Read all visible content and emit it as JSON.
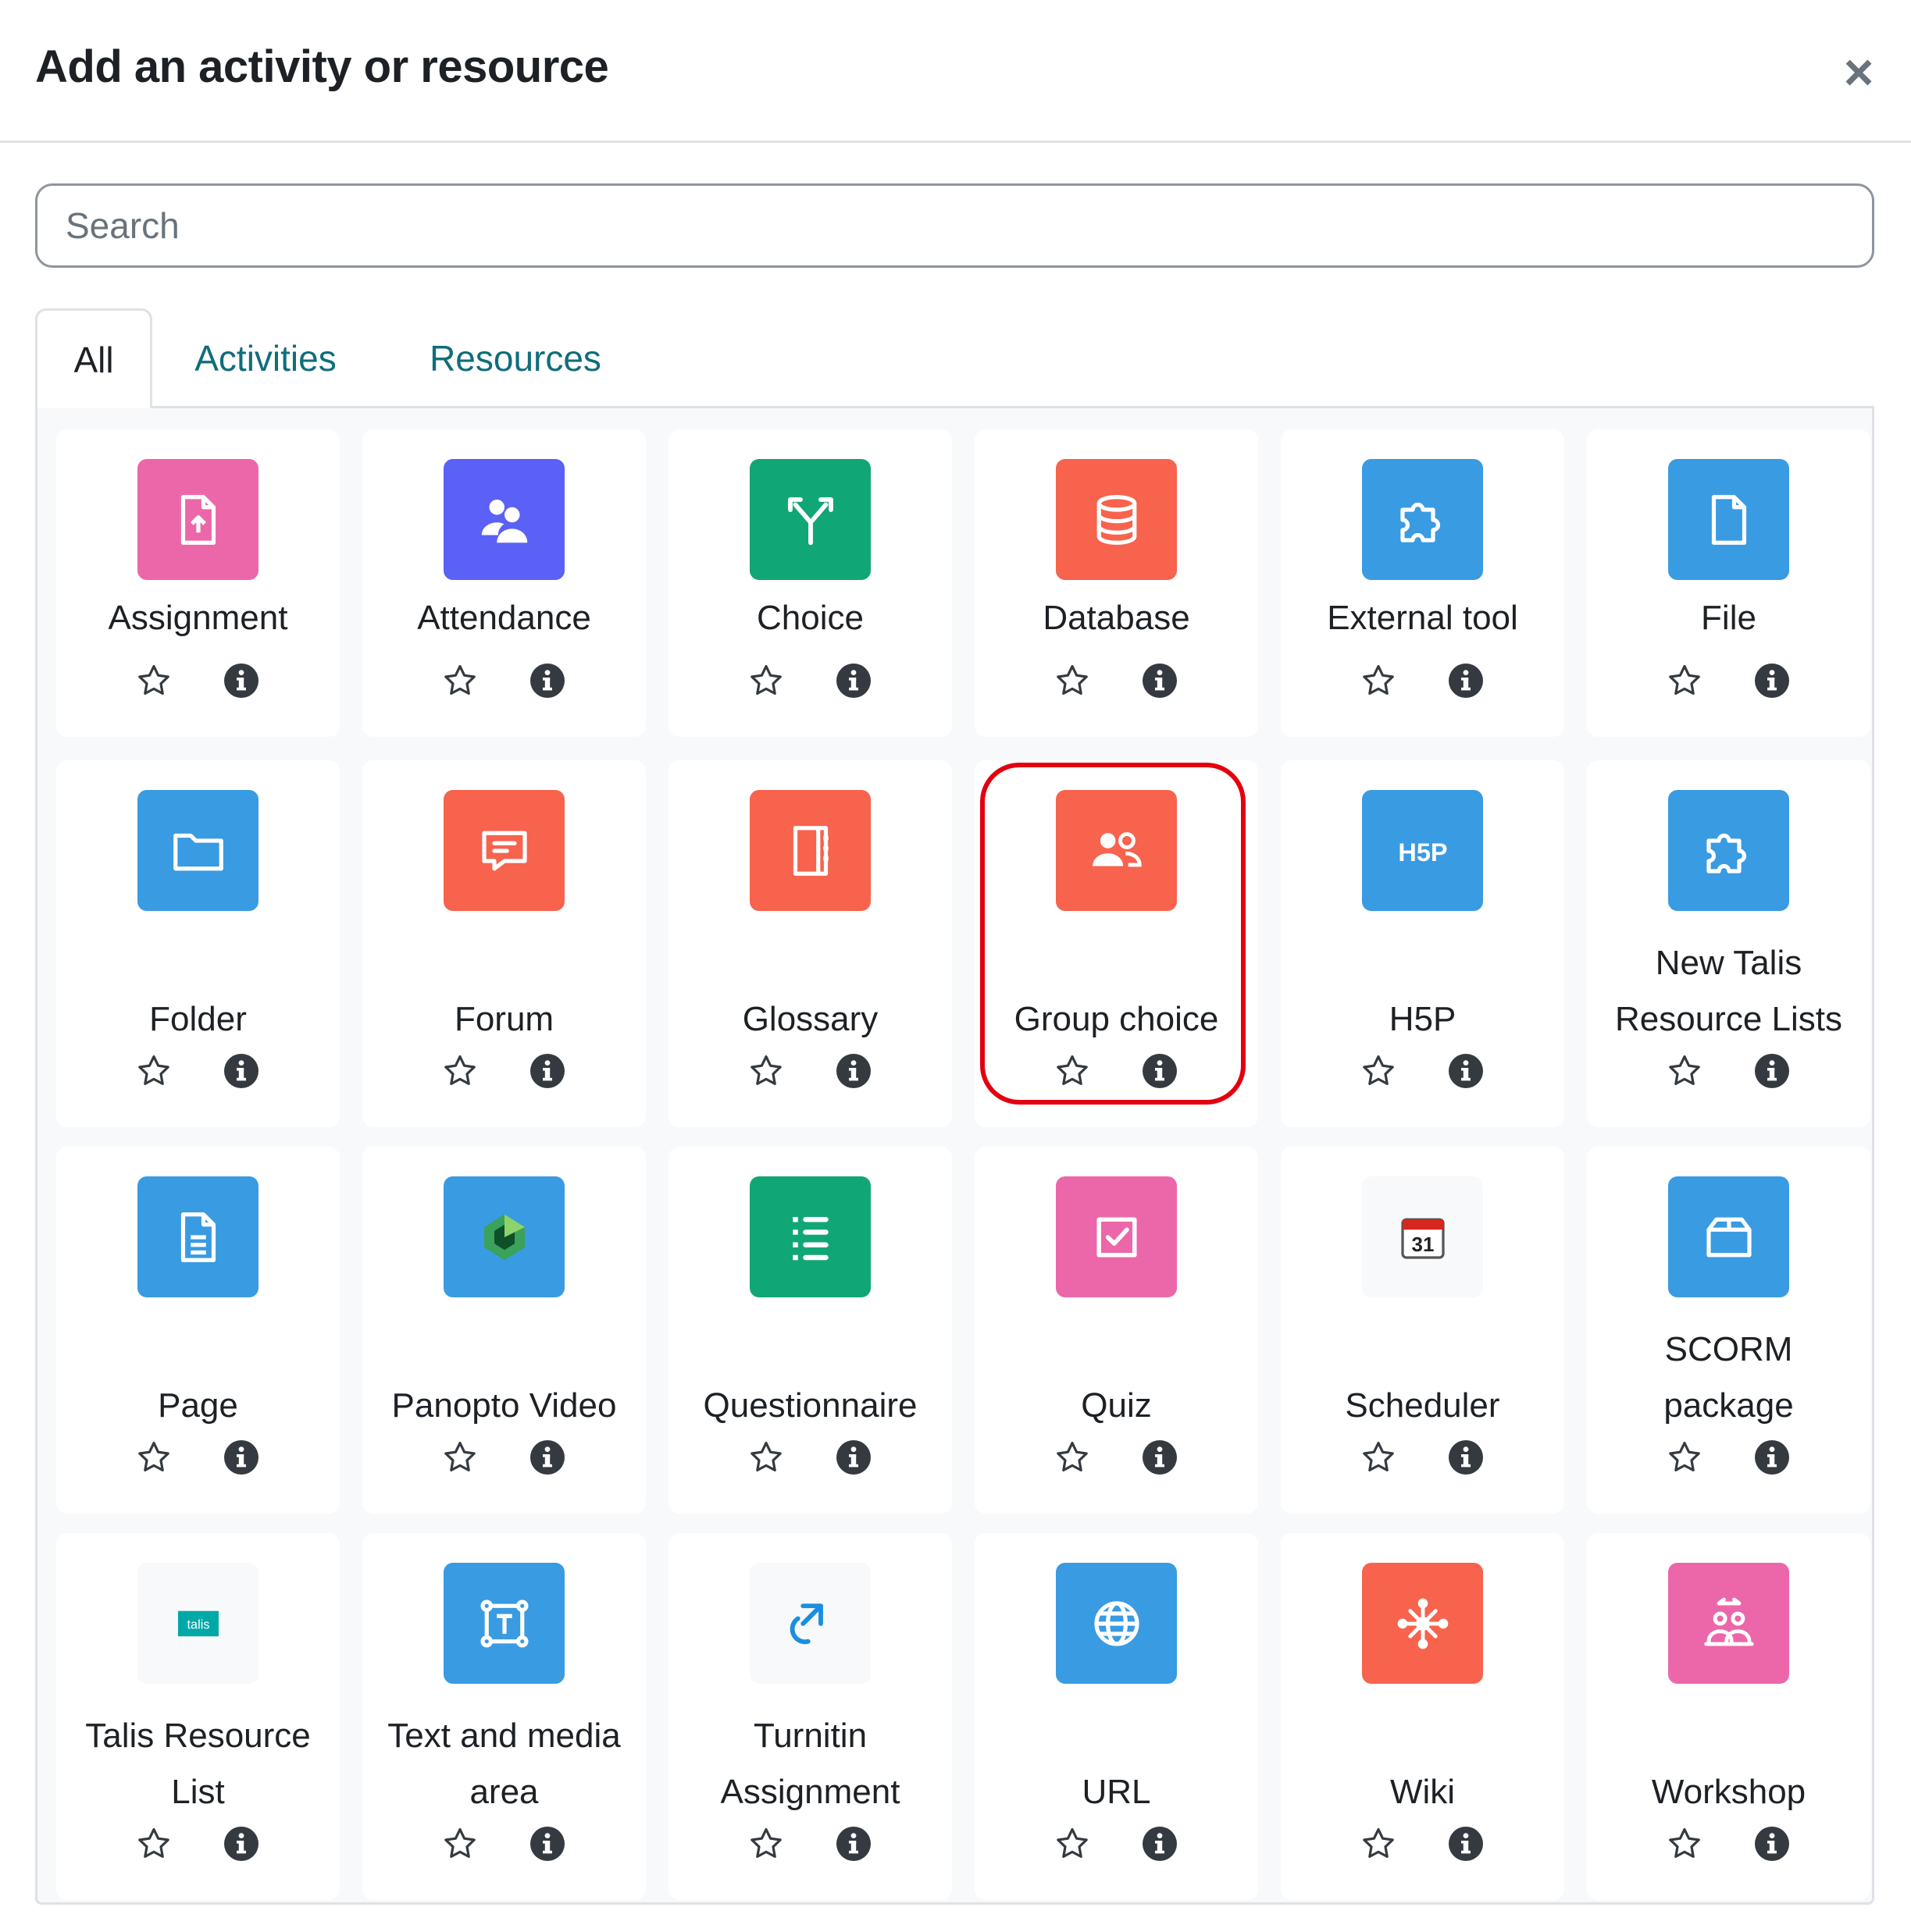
{
  "dialog": {
    "title": "Add an activity or resource",
    "close_glyph": "×"
  },
  "search": {
    "placeholder": "Search",
    "value": ""
  },
  "tabs": [
    {
      "label": "All",
      "active": true
    },
    {
      "label": "Activities",
      "active": false
    },
    {
      "label": "Resources",
      "active": false
    }
  ],
  "colors": {
    "assessment_pink": "#ec67a9",
    "collaboration_orange": "#f7634d",
    "content_blue": "#399be2",
    "communication_green": "#11a676",
    "attendance_purple": "#5b60f6",
    "tab_link": "#0f6e7a",
    "highlight_red": "#e3000f"
  },
  "items": [
    {
      "label": "Assignment",
      "icon": "assignment-icon",
      "color": "#ec67a9"
    },
    {
      "label": "Attendance",
      "icon": "attendance-icon",
      "color": "#5b60f6"
    },
    {
      "label": "Choice",
      "icon": "choice-icon",
      "color": "#11a676"
    },
    {
      "label": "Database",
      "icon": "database-icon",
      "color": "#f7634d"
    },
    {
      "label": "External tool",
      "icon": "puzzle-icon",
      "color": "#399be2"
    },
    {
      "label": "File",
      "icon": "file-icon",
      "color": "#399be2"
    },
    {
      "label": "Folder",
      "icon": "folder-icon",
      "color": "#399be2"
    },
    {
      "label": "Forum",
      "icon": "forum-icon",
      "color": "#f7634d"
    },
    {
      "label": "Glossary",
      "icon": "glossary-icon",
      "color": "#f7634d"
    },
    {
      "label": "Group choice",
      "icon": "group-choice-icon",
      "color": "#f7634d",
      "highlighted": true
    },
    {
      "label": "H5P",
      "icon": "h5p-icon",
      "color": "#399be2"
    },
    {
      "label": "New Talis Resource Lists",
      "icon": "puzzle-icon",
      "color": "#399be2"
    },
    {
      "label": "Page",
      "icon": "page-icon",
      "color": "#399be2"
    },
    {
      "label": "Panopto Video",
      "icon": "panopto-icon",
      "color": "#399be2"
    },
    {
      "label": "Questionnaire",
      "icon": "questionnaire-icon",
      "color": "#11a676"
    },
    {
      "label": "Quiz",
      "icon": "quiz-icon",
      "color": "#ec67a9"
    },
    {
      "label": "Scheduler",
      "icon": "calendar-icon",
      "color": "#f8f9fa",
      "calendar_day": "31"
    },
    {
      "label": "SCORM package",
      "icon": "scorm-package-icon",
      "color": "#399be2"
    },
    {
      "label": "Talis Resource List",
      "icon": "talis-logo-icon",
      "color": "#f8f9fa",
      "logo_text": "talis"
    },
    {
      "label": "Text and media area",
      "icon": "text-media-icon",
      "color": "#399be2"
    },
    {
      "label": "Turnitin Assignment",
      "icon": "turnitin-icon",
      "color": "#f8f9fa"
    },
    {
      "label": "URL",
      "icon": "globe-icon",
      "color": "#399be2"
    },
    {
      "label": "Wiki",
      "icon": "wiki-icon",
      "color": "#f7634d"
    },
    {
      "label": "Workshop",
      "icon": "workshop-icon",
      "color": "#ec67a9"
    }
  ]
}
